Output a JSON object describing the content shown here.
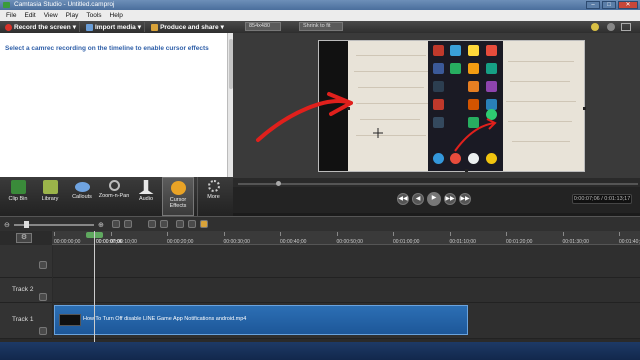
{
  "window": {
    "title": "Camtasia Studio - Untitled.camproj",
    "min": "–",
    "max": "□",
    "close": "✕"
  },
  "menu": [
    "File",
    "Edit",
    "View",
    "Play",
    "Tools",
    "Help"
  ],
  "toolbar": {
    "record": "Record the screen",
    "import": "Import media",
    "produce": "Produce and share"
  },
  "preview_toolbar": {
    "dimensions": "854x480",
    "zoom": "Shrink to fit"
  },
  "left_panel": {
    "message": "Select a camrec recording on the timeline to enable cursor effects"
  },
  "tabs": [
    {
      "label": "Clip Bin",
      "icon": "clip-bin-icon"
    },
    {
      "label": "Library",
      "icon": "library-icon"
    },
    {
      "label": "Callouts",
      "icon": "callouts-icon"
    },
    {
      "label": "Zoom-n-Pan",
      "icon": "zoom-n-pan-icon"
    },
    {
      "label": "Audio",
      "icon": "audio-icon"
    },
    {
      "label": "Cursor Effects",
      "icon": "cursor-effects-icon"
    },
    {
      "label": "More",
      "icon": "more-icon"
    }
  ],
  "player": {
    "timecode": "0:00:07;06 / 0:01:13;17",
    "prev": "◀◀",
    "back": "◀",
    "play": "▶",
    "next": "▶▶",
    "end": "▶▶"
  },
  "timeline": {
    "playhead_label": "00:00:07;06",
    "ruler": [
      "00:00:00;00",
      "00:00:10;00",
      "00:00:20;00",
      "00:00:30;00",
      "00:00:40;00",
      "00:00:50;00",
      "00:01:00;00",
      "00:01:10;00",
      "00:01:20;00",
      "00:01:30;00",
      "00:01:40;00"
    ],
    "tracks": [
      {
        "name": ""
      },
      {
        "name": "Track 2"
      },
      {
        "name": "Track 1"
      }
    ],
    "clip_label": "How To Turn Off disable LINE Game App Notifications android.mp4"
  },
  "colors": {
    "accent_blue": "#2c6fb4",
    "message_blue": "#2f5fa8",
    "arrow_red": "#e0201c"
  }
}
